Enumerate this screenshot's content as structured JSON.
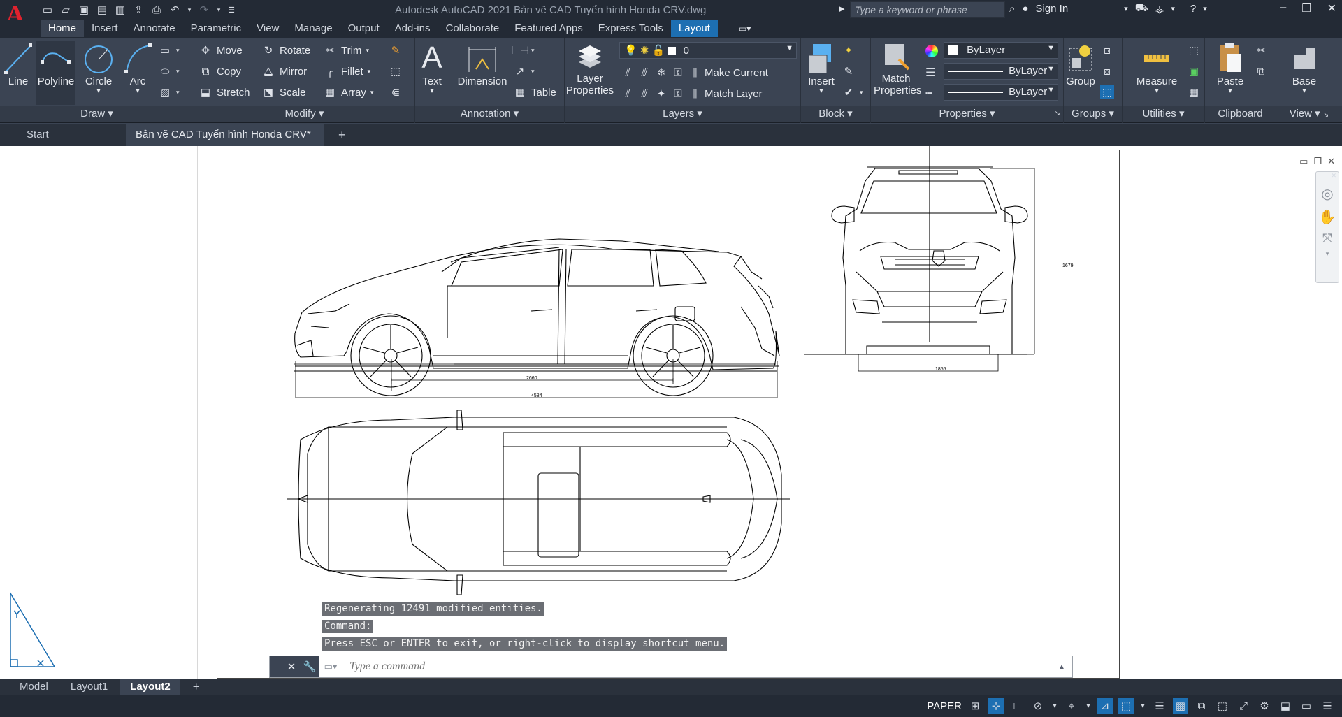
{
  "app": {
    "logo": "A",
    "title": "Autodesk AutoCAD 2021    Bản vẽ CAD Tuyển hình Honda CRV.dwg",
    "search_placeholder": "Type a keyword or phrase",
    "sign_in": "Sign In"
  },
  "ribbon_tabs": [
    "Home",
    "Insert",
    "Annotate",
    "Parametric",
    "View",
    "Manage",
    "Output",
    "Add-ins",
    "Collaborate",
    "Featured Apps",
    "Express Tools",
    "Layout"
  ],
  "panels": {
    "draw": {
      "title": "Draw",
      "line": "Line",
      "polyline": "Polyline",
      "circle": "Circle",
      "arc": "Arc"
    },
    "modify": {
      "title": "Modify",
      "move": "Move",
      "rotate": "Rotate",
      "trim": "Trim",
      "copy": "Copy",
      "mirror": "Mirror",
      "fillet": "Fillet",
      "stretch": "Stretch",
      "scale": "Scale",
      "array": "Array"
    },
    "annotation": {
      "title": "Annotation",
      "text": "Text",
      "dimension": "Dimension",
      "table": "Table"
    },
    "layers": {
      "title": "Layers",
      "layer_properties_1": "Layer",
      "layer_properties_2": "Properties",
      "current_layer": "0",
      "make_current": "Make Current",
      "match_layer": "Match Layer"
    },
    "block": {
      "title": "Block",
      "insert": "Insert"
    },
    "properties": {
      "title": "Properties",
      "match_1": "Match",
      "match_2": "Properties",
      "color": "ByLayer",
      "linetype": "ByLayer",
      "lineweight": "ByLayer"
    },
    "groups": {
      "title": "Groups",
      "group": "Group"
    },
    "utilities": {
      "title": "Utilities",
      "measure": "Measure"
    },
    "clipboard": {
      "title": "Clipboard",
      "paste": "Paste"
    },
    "view": {
      "title": "View",
      "base": "Base"
    }
  },
  "file_tabs": {
    "start": "Start",
    "active": "Bản vẽ CAD Tuyển hình Honda CRV*"
  },
  "dimensions": {
    "wheelbase": "2660",
    "length": "4584",
    "width": "1855",
    "height": "1679"
  },
  "command_history": [
    "Regenerating 12491 modified entities.",
    "Command:",
    "Press ESC or ENTER to exit, or right-click to display shortcut menu."
  ],
  "command_placeholder": "Type a command",
  "layout_tabs": [
    "Model",
    "Layout1",
    "Layout2"
  ],
  "status": {
    "space": "PAPER"
  },
  "colors": {
    "accent": "#1d6fb2",
    "ribbon_bg": "#3b4453",
    "title_bg": "#232a35",
    "logo_red": "#e0222e"
  }
}
